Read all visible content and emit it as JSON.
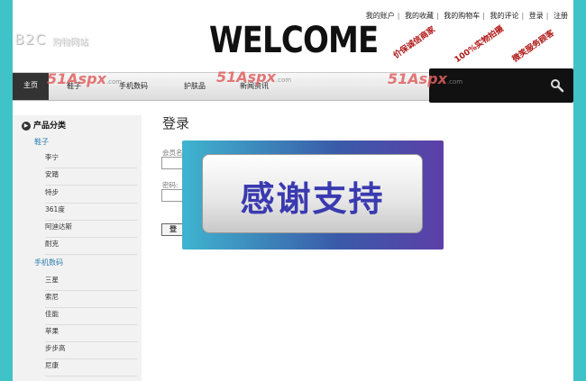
{
  "header": {
    "logo": "B2C",
    "logo_sub": "购物网站",
    "welcome": "WELCOME",
    "links": [
      "我的账户",
      "我的收藏",
      "我的购物车",
      "我的评论",
      "登录",
      "注册"
    ],
    "stamps": [
      "价保诚信商家",
      "100%实物拍摄",
      "微笑服务顾客"
    ]
  },
  "nav": {
    "home": "主页",
    "items": [
      "鞋子",
      "手机数码",
      "护肤品",
      "新闻资讯"
    ]
  },
  "search": {
    "value": "",
    "placeholder": ""
  },
  "watermark": {
    "text": "51Aspx",
    "suffix": ".com"
  },
  "sidebar": {
    "title": "产品分类",
    "categories": [
      {
        "name": "鞋子",
        "items": [
          "李宁",
          "安踏",
          "特步",
          "361度",
          "阿迪达斯",
          "耐克"
        ]
      },
      {
        "name": "手机数码",
        "items": [
          "三星",
          "索尼",
          "佳能",
          "苹果",
          "步步高",
          "尼康"
        ]
      }
    ]
  },
  "login": {
    "title": "登录",
    "username_label": "会员名",
    "password_label": "密码:",
    "button": "登"
  },
  "modal": {
    "text": "感谢支持"
  },
  "colors": {
    "background": "#3fc2c8",
    "accent": "#2b7fb0",
    "modal_text": "#3a3ab0"
  }
}
